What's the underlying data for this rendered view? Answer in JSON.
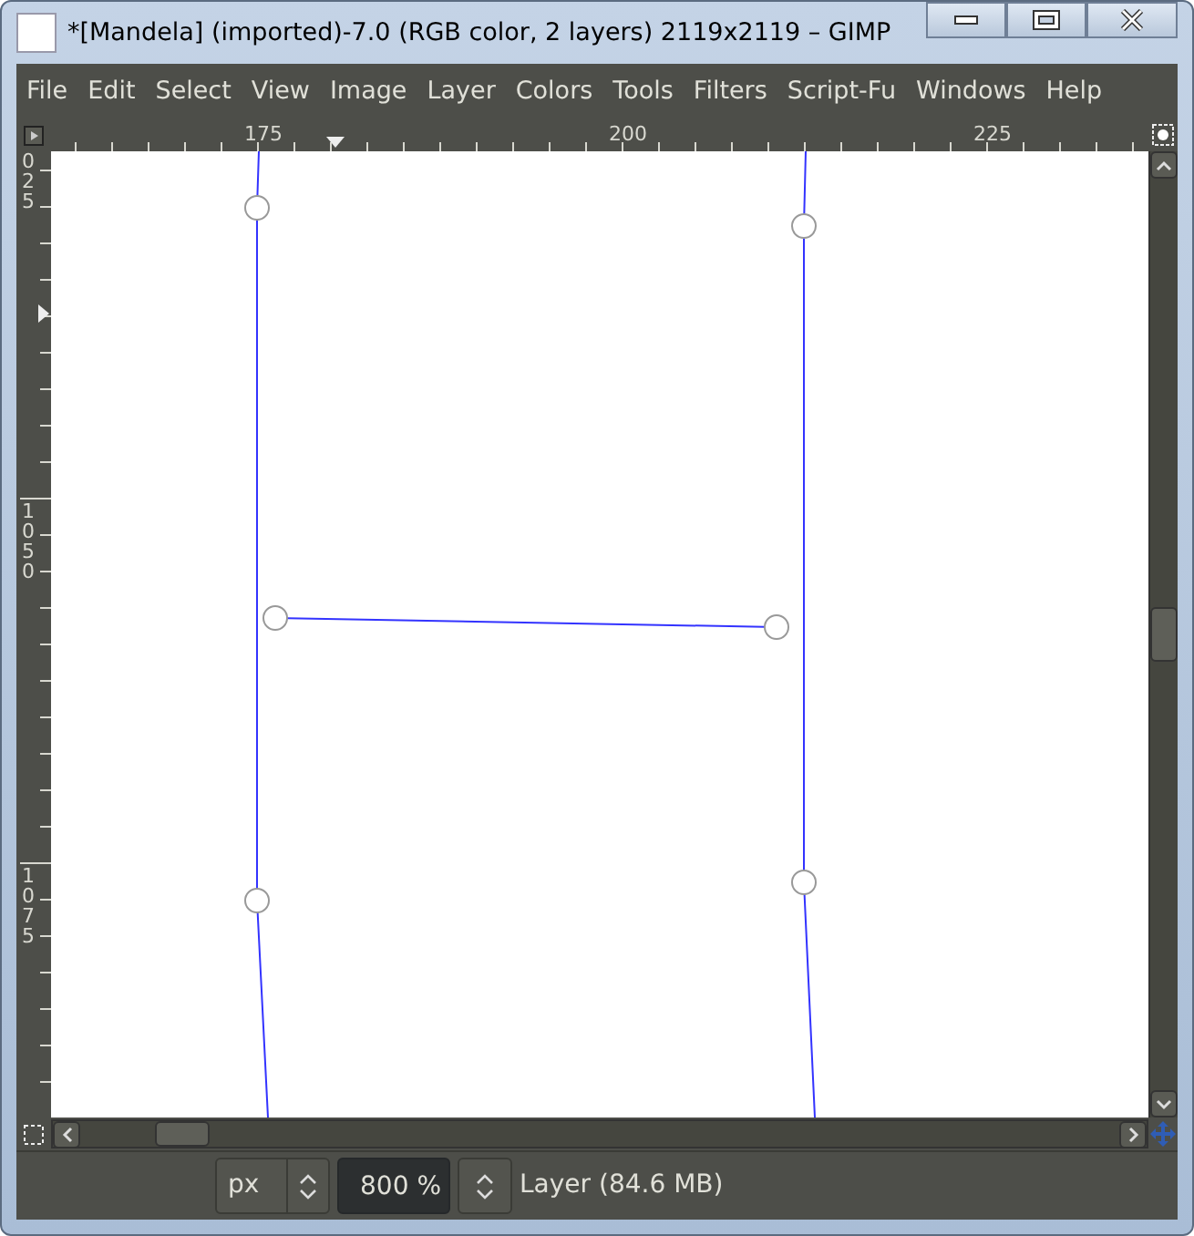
{
  "window": {
    "title": "*[Mandela] (imported)-7.0 (RGB color, 2 layers) 2119x2119 – GIMP"
  },
  "menu": [
    {
      "label": "File"
    },
    {
      "label": "Edit"
    },
    {
      "label": "Select"
    },
    {
      "label": "View"
    },
    {
      "label": "Image"
    },
    {
      "label": "Layer"
    },
    {
      "label": "Colors"
    },
    {
      "label": "Tools"
    },
    {
      "label": "Filters"
    },
    {
      "label": "Script-Fu"
    },
    {
      "label": "Windows"
    },
    {
      "label": "Help"
    }
  ],
  "horizontal_ruler": {
    "labels": [
      "175",
      "200",
      "225"
    ]
  },
  "vertical_ruler": {
    "labels": [
      "025",
      "1050",
      "1075"
    ]
  },
  "status_bar": {
    "unit": "px",
    "zoom": "800 %",
    "layer_info": "Layer (84.6 MB)"
  }
}
